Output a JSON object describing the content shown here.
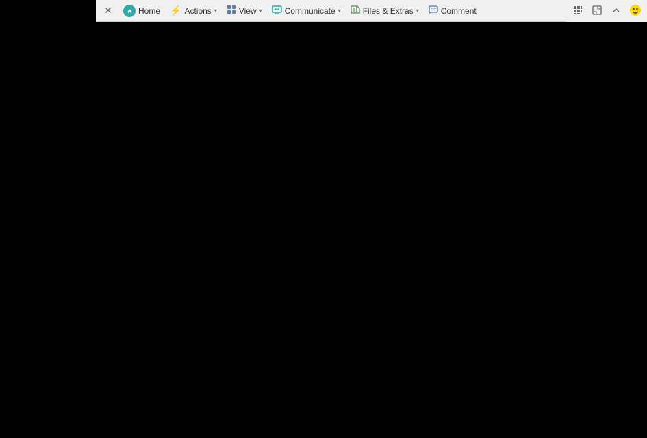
{
  "toolbar": {
    "close_label": "✕",
    "home_label": "Home",
    "actions_label": "Actions",
    "view_label": "View",
    "communicate_label": "Communicate",
    "files_extras_label": "Files & Extras",
    "comment_label": "Comment",
    "chevron": "▾"
  },
  "toolbar_right": {
    "grid_title": "Grid view",
    "resize_title": "Resize",
    "collapse_title": "Collapse",
    "emoji_title": "Emoji"
  },
  "main": {
    "background_color": "#000000"
  }
}
